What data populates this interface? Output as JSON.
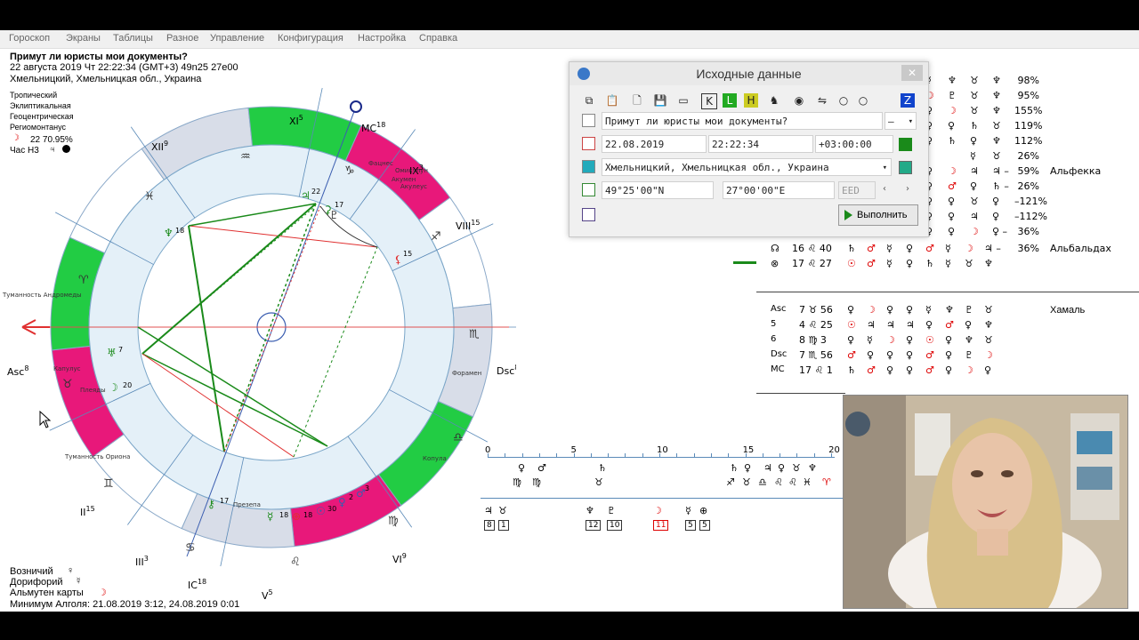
{
  "menu": [
    "Гороскоп",
    "Экраны",
    "Таблицы",
    "Разное",
    "Управление",
    "Конфигурация",
    "Настройка",
    "Справка"
  ],
  "header": {
    "title": "Примут ли юристы мои документы?",
    "datetime": "22 августа 2019  Чт  22:22:34 (GMT+3) 49n25  27e00",
    "place": "Хмельницкий, Хмельницкая обл., Украина"
  },
  "settings": [
    "Тропический",
    "Эклиптикальная",
    "Геоцентрическая",
    "Региомонтанус"
  ],
  "moon_line": "22 70.95%",
  "hour_line": "Час Н3",
  "house_labels": {
    "xi": "XI",
    "xi_deg": "5",
    "mc": "MC",
    "mc_deg": "18",
    "ix": "IX",
    "ix_deg": "3",
    "viii": "VIII",
    "viii_deg": "15",
    "dsc": "Dsc",
    "dsc_deg": "8",
    "xii": "XII",
    "xii_deg": "9",
    "asc": "Asc",
    "asc_deg": "8",
    "ii": "II",
    "ii_deg": "15",
    "iii": "III",
    "iii_deg": "3",
    "ic": "IC",
    "ic_deg": "18",
    "v": "V",
    "v_deg": "5",
    "vi": "VI",
    "vi_deg": "9"
  },
  "stars": [
    "Фацнес",
    "Омикулун",
    "Акумен",
    "Акулеус",
    "Туманность Андромеды",
    "Капулус",
    "Плеяды",
    "Туманность Ориона",
    "Презепа",
    "Форамен",
    "Копула"
  ],
  "planet_degrees": [
    "22",
    "17",
    "18",
    "15",
    "7",
    "20",
    "17",
    "18",
    "18",
    "30",
    "2",
    "3"
  ],
  "dialog": {
    "title": "Исходные данные",
    "question": "Примут ли юристы мои документы?",
    "question_select": "—",
    "date": "22.08.2019",
    "time": "22:22:34",
    "tz": "+03:00:00",
    "place": "Хмельницкий, Хмельницкая обл., Украина",
    "lat": "49°25'00\"N",
    "lon": "27°00'00\"E",
    "eed": "EED",
    "run": "Выполнить",
    "toolbar_glyphs": [
      "⧉",
      "📋",
      "🗋",
      "💾",
      "▭",
      "K",
      "L",
      "H",
      "♞",
      "◉",
      "⇋",
      "○",
      "○",
      "Z"
    ]
  },
  "top_table": [
    {
      "a": "☿",
      "b": "♆",
      "c": "♉",
      "d": "♆",
      "pct": "98%",
      "star": ""
    },
    {
      "a": "☽",
      "b": "♇",
      "c": "♉",
      "d": "♆",
      "pct": "95%",
      "star": ""
    },
    {
      "a": "♀",
      "b": "☽",
      "c": "♉",
      "d": "♆",
      "pct": "155%",
      "star": ""
    },
    {
      "a": "♀",
      "b": "♀",
      "c": "♄",
      "d": "♉",
      "pct": "119%",
      "star": ""
    },
    {
      "a": "♀",
      "b": "♄",
      "c": "♀",
      "d": "♆",
      "pct": "112%",
      "star": ""
    },
    {
      "a": "",
      "b": "",
      "c": "☿",
      "d": "♉",
      "pct": "26%",
      "star": ""
    },
    {
      "a": "♀",
      "b": "☽",
      "c": "♃",
      "d": "♃ –",
      "pct": "59%",
      "star": "Альфекка"
    },
    {
      "a": "♀",
      "b": "♂",
      "c": "♀",
      "d": "♄ –",
      "pct": "26%",
      "star": ""
    },
    {
      "a": "♀",
      "b": "♀",
      "c": "♉",
      "d": "♀",
      "pct": "–121%",
      "star": ""
    },
    {
      "a": "♀",
      "b": "♀",
      "c": "♃",
      "d": "♀",
      "pct": "–112%",
      "star": ""
    },
    {
      "a": "♀",
      "b": "♀",
      "c": "☽",
      "d": "♀ –",
      "pct": "36%",
      "star": ""
    }
  ],
  "top_table_full": [
    {
      "sym": "☊",
      "deg": "16",
      "sign": "♌",
      "min": "40",
      "cols": [
        "♄",
        "♂",
        "☿",
        "♀",
        "♂",
        "☿",
        "☽",
        "♃ –"
      ],
      "pct": "36%",
      "star": "Альбальдах"
    },
    {
      "sym": "⊗",
      "deg": "17",
      "sign": "♌",
      "min": "27",
      "cols": [
        "☉",
        "♂",
        "☿",
        "♀",
        "♄",
        "☿",
        "♉",
        "♆"
      ],
      "pct": "",
      "star": ""
    }
  ],
  "bottom_table": {
    "star": "Хамаль",
    "rows": [
      {
        "sym": "Asc",
        "deg": "7",
        "sign": "♉",
        "min": "56",
        "cols": [
          "♀",
          "☽",
          "♀",
          "♀",
          "☿",
          "♆",
          "♇",
          "♉"
        ]
      },
      {
        "sym": "5",
        "deg": "4",
        "sign": "♌",
        "min": "25",
        "cols": [
          "☉",
          "♃",
          "♃",
          "♃",
          "♀",
          "♂",
          "♀",
          "♆"
        ]
      },
      {
        "sym": "6",
        "deg": "8",
        "sign": "♍",
        "min": "3",
        "cols": [
          "♀",
          "☿",
          "☽",
          "♀",
          "☉",
          "♀",
          "♆",
          "♉"
        ]
      },
      {
        "sym": "Dsc",
        "deg": "7",
        "sign": "♏",
        "min": "56",
        "cols": [
          "♂",
          "♀",
          "♀",
          "♀",
          "♂",
          "♀",
          "♇",
          "☽"
        ]
      },
      {
        "sym": "MC",
        "deg": "17",
        "sign": "♌",
        "min": "1",
        "cols": [
          "♄",
          "♂",
          "♀",
          "♀",
          "♂",
          "♀",
          "☽",
          "♀"
        ]
      }
    ]
  },
  "timeline": {
    "ticks": [
      "0",
      "5",
      "10",
      "15",
      "20"
    ],
    "upper": [
      "♀",
      "♂",
      "♄",
      "♄",
      "♀",
      "♃",
      "♀",
      "♉",
      "♆"
    ],
    "upper2": [
      "♍",
      "♍",
      "♉",
      "♐",
      "♉",
      "♎",
      "♌",
      "♌",
      "♓",
      "♈"
    ],
    "lower": [
      "♃",
      "♉",
      "♆",
      "♇",
      "☽",
      "☿",
      "⊕"
    ],
    "lower_boxes": [
      "8",
      "1",
      "12",
      "10",
      "11",
      "5",
      "5"
    ]
  },
  "footer": {
    "vozn": "Возничий",
    "dorif": "Дорифорий",
    "almuten": "Альмутен карты",
    "minimum": "Минимум Алголя: 21.08.2019  3:12,  24.08.2019  0:01"
  },
  "colors": {
    "green": "#22cc44",
    "pink": "#e8187a",
    "gray_sector": "#d8dde8",
    "inner_ring": "#e4f0f8",
    "aspect_green": "#1a8a1a",
    "aspect_red": "#e03030"
  }
}
